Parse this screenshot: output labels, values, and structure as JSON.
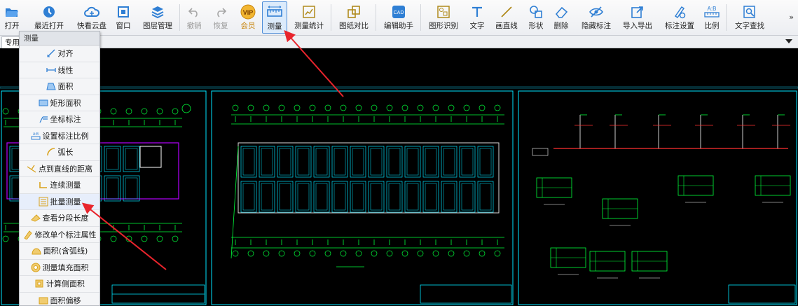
{
  "toolbar": {
    "buttons": [
      {
        "label": "打开",
        "icon": "folder-open-icon"
      },
      {
        "label": "最近打开",
        "icon": "history-icon"
      },
      {
        "label": "快看云盘",
        "icon": "cloud-icon"
      },
      {
        "label": "窗口",
        "icon": "window-icon"
      },
      {
        "label": "图层管理",
        "icon": "layers-icon"
      },
      {
        "label": "撤销",
        "icon": "undo-icon"
      },
      {
        "label": "恢复",
        "icon": "redo-icon"
      },
      {
        "label": "会员",
        "icon": "vip-icon",
        "badge": "VIP"
      },
      {
        "label": "测量",
        "icon": "measure-ruler-icon"
      },
      {
        "label": "测量统计",
        "icon": "measure-stats-icon"
      },
      {
        "label": "图纸对比",
        "icon": "compare-icon"
      },
      {
        "label": "编辑助手",
        "icon": "edit-assistant-icon"
      },
      {
        "label": "图形识别",
        "icon": "shape-recognize-icon"
      },
      {
        "label": "文字",
        "icon": "text-icon"
      },
      {
        "label": "画直线",
        "icon": "line-icon"
      },
      {
        "label": "形状",
        "icon": "shape-icon"
      },
      {
        "label": "删除",
        "icon": "eraser-icon"
      },
      {
        "label": "隐藏标注",
        "icon": "eye-hidden-icon"
      },
      {
        "label": "导入导出",
        "icon": "import-export-icon"
      },
      {
        "label": "标注设置",
        "icon": "annotation-settings-icon"
      },
      {
        "label": "比例",
        "icon": "scale-icon",
        "badge": "A:B"
      },
      {
        "label": "文字查找",
        "icon": "text-search-icon"
      }
    ],
    "more": "»"
  },
  "tabs": {
    "first": "专用"
  },
  "panel": {
    "title": "测量",
    "items": [
      {
        "label": "对齐",
        "icon": "align-icon"
      },
      {
        "label": "线性",
        "icon": "linear-icon"
      },
      {
        "label": "面积",
        "icon": "area-icon"
      },
      {
        "label": "矩形面积",
        "icon": "rect-area-icon"
      },
      {
        "label": "坐标标注",
        "icon": "coordinate-icon"
      },
      {
        "label": "设置标注比例",
        "icon": "scale-setting-icon",
        "badge": "A:B"
      },
      {
        "label": "弧长",
        "icon": "arc-length-icon"
      },
      {
        "label": "点到直线的距离",
        "icon": "point-line-distance-icon"
      },
      {
        "label": "连续测量",
        "icon": "continuous-measure-icon"
      },
      {
        "label": "批量测量",
        "icon": "batch-measure-icon"
      },
      {
        "label": "查看分段长度",
        "icon": "segment-length-icon"
      },
      {
        "label": "修改单个标注属性",
        "icon": "edit-annotation-icon"
      },
      {
        "label": "面积(含弧线)",
        "icon": "arc-area-icon"
      },
      {
        "label": "测量填充面积",
        "icon": "fill-area-icon"
      },
      {
        "label": "计算侧面积",
        "icon": "side-area-icon"
      },
      {
        "label": "面积偏移",
        "icon": "area-offset-icon"
      }
    ]
  },
  "colors": {
    "accent": "#2b7bd6",
    "arrow": "#e8242c",
    "drawing_green": "#00ff3a",
    "drawing_cyan": "#00e5ff",
    "drawing_magenta": "#b400ff"
  }
}
